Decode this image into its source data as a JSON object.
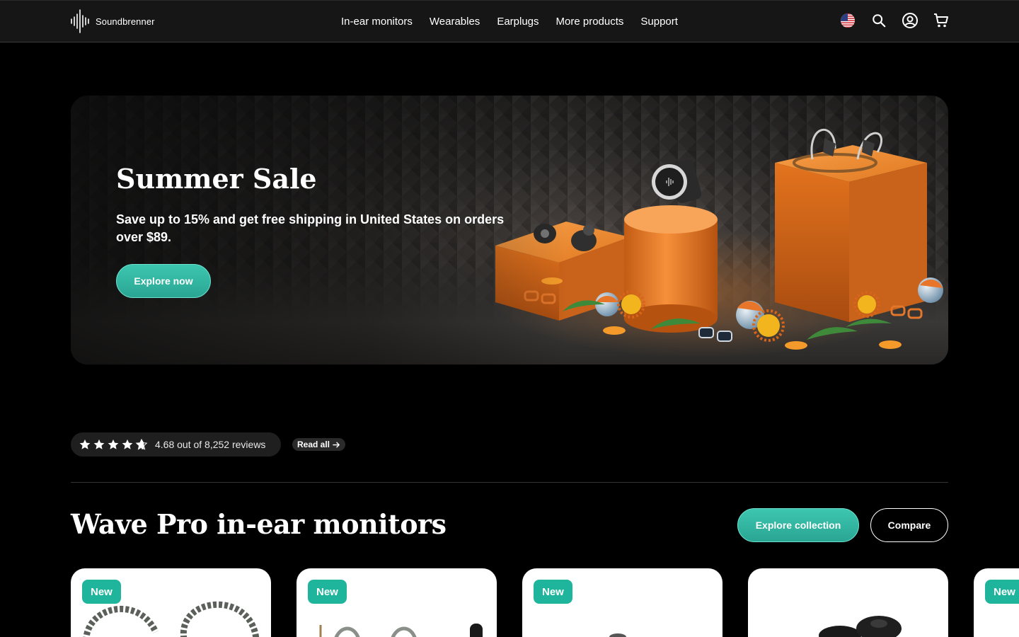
{
  "header": {
    "brand": "Soundbrenner",
    "nav": [
      "In-ear monitors",
      "Wearables",
      "Earplugs",
      "More products",
      "Support"
    ],
    "icons": [
      "us-flag-icon",
      "search-icon",
      "account-icon",
      "cart-icon"
    ]
  },
  "hero": {
    "title": "Summer Sale",
    "subtitle": "Save up to 15% and get free shipping in United States on orders over $89.",
    "cta": "Explore now"
  },
  "reviews": {
    "rating_value": 4.68,
    "stars_out_of": 5,
    "text": "4.68 out of 8,252 reviews",
    "read_all": "Read all"
  },
  "section": {
    "title": "Wave Pro in-ear monitors",
    "explore": "Explore collection",
    "compare": "Compare"
  },
  "products": [
    {
      "badge": "New"
    },
    {
      "badge": "New"
    },
    {
      "badge": "New"
    },
    {
      "badge": ""
    },
    {
      "badge": "New"
    }
  ],
  "colors": {
    "accent": "#2ab39d",
    "header_bg": "#161616",
    "page_bg": "#000000",
    "sale_orange": "#e8731f"
  }
}
